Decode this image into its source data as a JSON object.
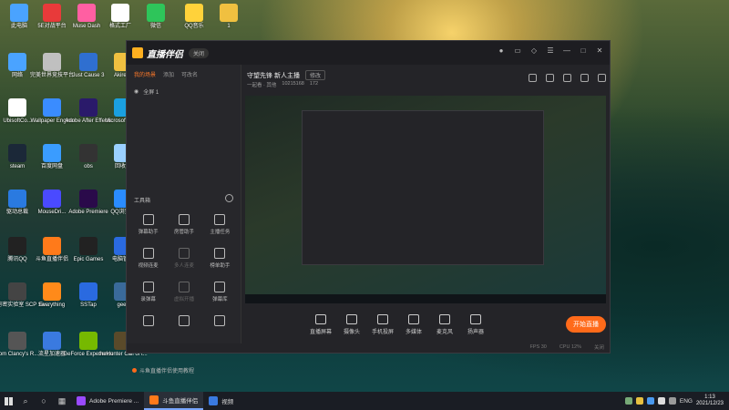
{
  "desktop_icons": [
    {
      "label": "此电脑",
      "color": "#4aa3ff"
    },
    {
      "label": "5E对战平台",
      "color": "#e83a3a"
    },
    {
      "label": "Muse Dash",
      "color": "#ff5fa2"
    },
    {
      "label": "格式工厂",
      "color": "#ffffff"
    },
    {
      "label": "微信",
      "color": "#2ec55a"
    },
    {
      "label": "QQ音乐",
      "color": "#ffd23a"
    },
    {
      "label": "1",
      "color": "#f0c040"
    },
    {
      "label": "网络",
      "color": "#4aa3ff"
    },
    {
      "label": "完美世界竞技平台",
      "color": "#c0c0c0"
    },
    {
      "label": "Just Cause 3",
      "color": "#2f6fd0"
    },
    {
      "label": "Akireco",
      "color": "#f0c040"
    },
    {
      "label": "UbisoftCo...",
      "color": "#ffffff"
    },
    {
      "label": "Wallpaper Engine",
      "color": "#3a8cff"
    },
    {
      "label": "Adobe After Effects",
      "color": "#2a1a6a"
    },
    {
      "label": "Microsoft Edge",
      "color": "#1aa0e0"
    },
    {
      "label": "steam",
      "color": "#1b2838"
    },
    {
      "label": "百度网盘",
      "color": "#3a9cff"
    },
    {
      "label": "obs",
      "color": "#333333"
    },
    {
      "label": "回收站",
      "color": "#9ad0ff"
    },
    {
      "label": "驱动总裁",
      "color": "#2a7ae0"
    },
    {
      "label": "MouseDri...",
      "color": "#4a4aff"
    },
    {
      "label": "Adobe Premiere",
      "color": "#2a0a4a"
    },
    {
      "label": "QQ浏览器",
      "color": "#2a8cff"
    },
    {
      "label": "腾讯QQ",
      "color": "#222222"
    },
    {
      "label": "斗鱼直播伴侣",
      "color": "#ff7a1a"
    },
    {
      "label": "Epic Games",
      "color": "#222222"
    },
    {
      "label": "电脑管家",
      "color": "#2a6ae0"
    },
    {
      "label": "SCP秘密实验室 SCP Se...",
      "color": "#444444"
    },
    {
      "label": "Everything",
      "color": "#ff8a1a"
    },
    {
      "label": "SSTap",
      "color": "#2a6ae0"
    },
    {
      "label": "geek",
      "color": "#3a6a9a"
    },
    {
      "label": "Tom Clancy's R...",
      "color": "#555555"
    },
    {
      "label": "流星加速器",
      "color": "#3a7ae0"
    },
    {
      "label": "GeForce Experience",
      "color": "#76b900"
    },
    {
      "label": "theHunter Call of t...",
      "color": "#5a4a2a"
    }
  ],
  "app": {
    "title": "直播伴侣",
    "pill": "关闭",
    "left_tabs": [
      "我的场景",
      "添加",
      "可改名"
    ],
    "scene_label": "全屏 1",
    "tools_title": "工具箱",
    "tools": [
      {
        "label": "弹幕助手",
        "dim": false
      },
      {
        "label": "房管助手",
        "dim": false
      },
      {
        "label": "主播任务",
        "dim": false
      },
      {
        "label": "视频连麦",
        "dim": false
      },
      {
        "label": "多人连麦",
        "dim": true
      },
      {
        "label": "榜单助手",
        "dim": false
      },
      {
        "label": "录弹幕",
        "dim": false
      },
      {
        "label": "虚拟开播",
        "dim": true
      },
      {
        "label": "弹幕库",
        "dim": false
      },
      {
        "label": "",
        "dim": false
      },
      {
        "label": "",
        "dim": false
      },
      {
        "label": "",
        "dim": false
      }
    ],
    "tip": "斗鱼直播伴侣使用教程",
    "room_title": "守望先锋 新人主播",
    "edit_label": "修改",
    "meta": [
      "一起看 · 其他",
      "10215168",
      "172"
    ],
    "controls": [
      "直播屏幕",
      "摄像头",
      "手机投屏",
      "多媒体",
      "麦克风",
      "扬声器"
    ],
    "go_live": "开始直播",
    "status": [
      "FPS 30",
      "CPU 12%",
      "关闭"
    ]
  },
  "taskbar": {
    "apps": [
      {
        "label": "Adobe Premiere ...",
        "color": "#9a4aff",
        "active": false
      },
      {
        "label": "斗鱼直播伴侣",
        "color": "#ff7a1a",
        "active": true
      },
      {
        "label": "视频",
        "color": "#3a7ae0",
        "active": false
      }
    ],
    "lang": "ENG",
    "time": "1:13",
    "date": "2021/12/23"
  }
}
